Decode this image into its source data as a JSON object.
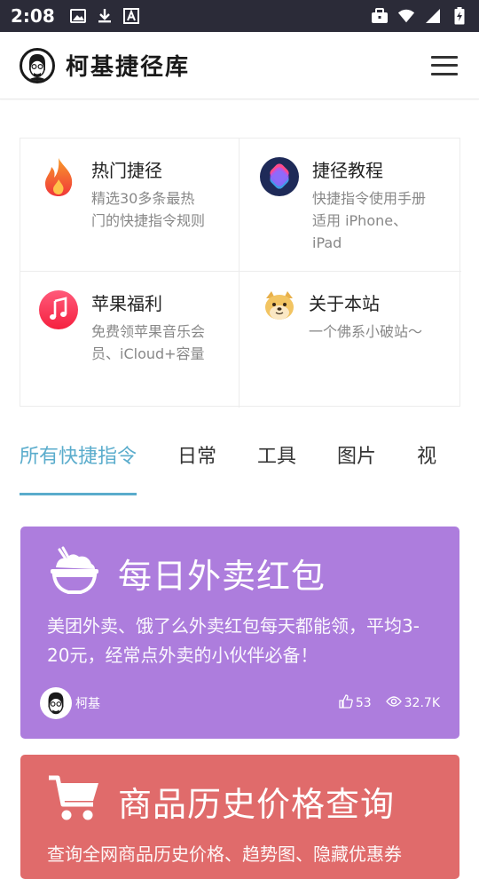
{
  "status_bar": {
    "time": "2:08",
    "left_icons": [
      "image-icon",
      "download-icon",
      "font-icon"
    ],
    "right_icons": [
      "briefcase-icon",
      "wifi-icon",
      "signal-icon",
      "battery-icon"
    ]
  },
  "header": {
    "title": "柯基捷径库",
    "menu_icon": "hamburger-menu-icon"
  },
  "features": [
    {
      "title": "热门捷径",
      "desc": [
        "精选30多条最热",
        "门的快捷指令规则"
      ],
      "icon": "fire-icon"
    },
    {
      "title": "捷径教程",
      "desc": [
        "快捷指令使用手册",
        "适用 iPhone、",
        "iPad"
      ],
      "icon": "shortcuts-icon"
    },
    {
      "title": "苹果福利",
      "desc": [
        "免费领苹果音乐会",
        "员、iCloud+容量"
      ],
      "icon": "music-icon"
    },
    {
      "title": "关于本站",
      "desc": [
        "一个佛系小破站〜"
      ],
      "icon": "doge-icon"
    }
  ],
  "tabs": [
    "所有快捷指令",
    "日常",
    "工具",
    "图片",
    "视"
  ],
  "active_tab": 0,
  "cards": [
    {
      "title": "每日外卖红包",
      "desc": [
        "美团外卖、饿了么外卖红包每天都能领，平均3-",
        "20元，经常点外卖的小伙伴必备！"
      ],
      "icon": "rice-bowl-icon",
      "author": "柯基",
      "likes": "53",
      "views": "32.7K",
      "color": "#ad7ddd"
    },
    {
      "title": "商品历史价格查询",
      "desc": [
        "查询全网商品历史价格、趋势图、隐藏优惠券"
      ],
      "icon": "shopping-cart-icon",
      "color": "#e06b6b"
    }
  ],
  "colors": {
    "accent": "#5aaccc",
    "status_bar": "#2b2b38"
  }
}
